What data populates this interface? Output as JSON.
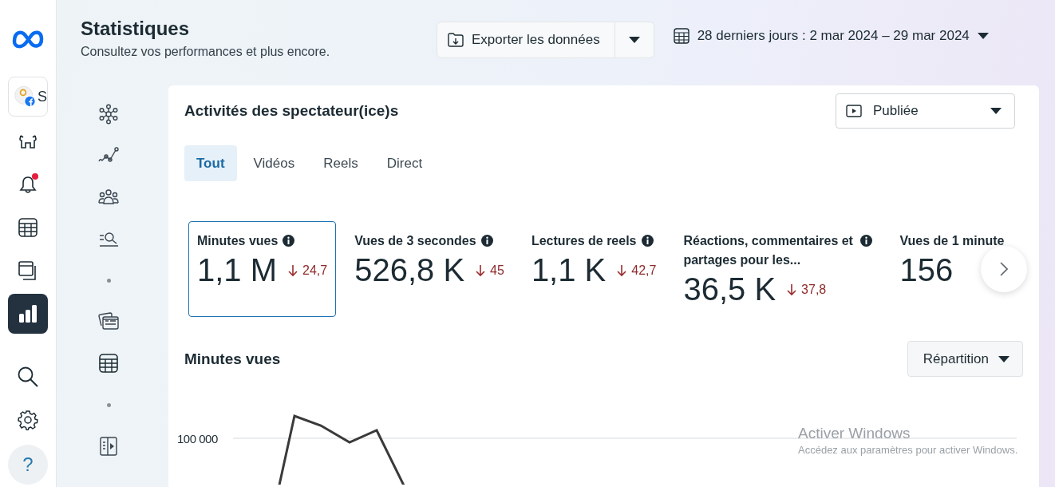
{
  "nav": {
    "account": {
      "name": "S"
    },
    "items": [
      {
        "kind": "home",
        "selected": false,
        "badge": false
      },
      {
        "kind": "bell",
        "selected": false,
        "badge": true
      },
      {
        "kind": "table",
        "selected": false,
        "badge": false
      },
      {
        "kind": "windows",
        "selected": false,
        "badge": false
      },
      {
        "kind": "chart",
        "selected": true,
        "badge": false
      }
    ],
    "bottom": [
      {
        "kind": "search"
      },
      {
        "kind": "settings"
      }
    ],
    "help": {
      "label": "?"
    }
  },
  "header": {
    "title": "Statistiques",
    "subtitle": "Consultez vos performances et plus encore.",
    "export": {
      "label": "Exporter les données"
    },
    "date_range": {
      "label": "28 derniers jours : 2 mar 2024 – 29 mar 2024"
    }
  },
  "rail": [
    {
      "kind": "network"
    },
    {
      "kind": "trend"
    },
    {
      "kind": "people"
    },
    {
      "kind": "search-list"
    },
    {
      "kind": "separator"
    },
    {
      "kind": "cards"
    },
    {
      "kind": "table"
    },
    {
      "kind": "separator"
    },
    {
      "kind": "panel"
    }
  ],
  "card": {
    "title": "Activités des spectateur(ice)s",
    "filter": {
      "label": "Publiée"
    },
    "tabs": [
      {
        "label": "Tout",
        "selected": true
      },
      {
        "label": "Vidéos",
        "selected": false
      },
      {
        "label": "Reels",
        "selected": false
      },
      {
        "label": "Direct",
        "selected": false
      }
    ],
    "metrics": [
      {
        "title": "Minutes vues",
        "info": true,
        "value": "1,1 M",
        "delta": "24,7",
        "selected": true
      },
      {
        "title": "Vues de 3 secondes",
        "info": true,
        "value": "526,8 K",
        "delta": "45",
        "selected": false
      },
      {
        "title": "Lectures de reels",
        "info": true,
        "value": "1,1 K",
        "delta": "42,7",
        "selected": false
      },
      {
        "title": "Réactions, commentaires et partages pour les...",
        "info": true,
        "value": "36,5 K",
        "delta": "37,8",
        "selected": false
      },
      {
        "title": "Vues de 1 minute",
        "info": false,
        "value": "156",
        "selected": false
      }
    ],
    "chart": {
      "title": "Minutes vues",
      "breakdown": {
        "label": "Répartition"
      },
      "tick_label": "100 000",
      "kind": "picture"
    }
  },
  "os_notice": {
    "title": "Activer Windows",
    "text": "Accédez aux paramètres pour activer Windows."
  }
}
